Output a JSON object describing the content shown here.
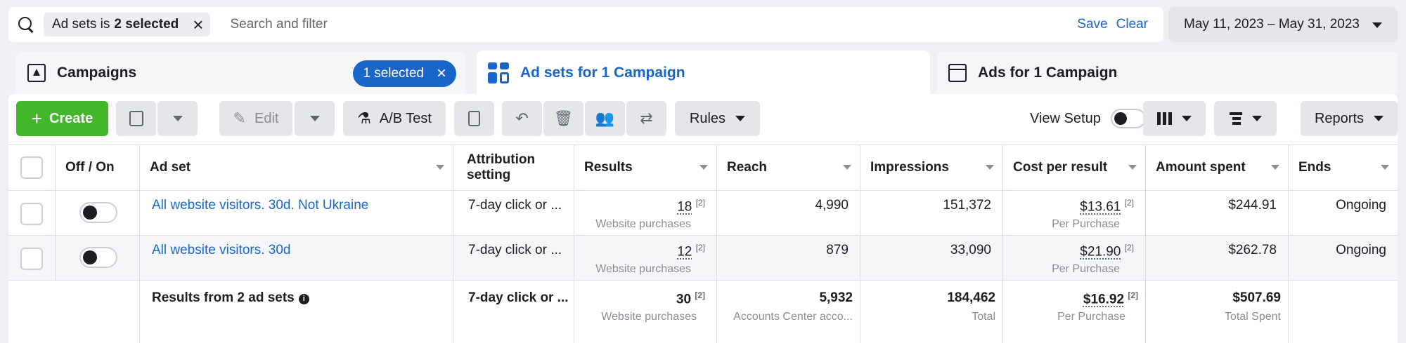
{
  "search": {
    "filter_prefix": "Ad sets is",
    "filter_value": "2 selected",
    "chip_close": "×",
    "placeholder": "Search and filter",
    "save": "Save",
    "clear": "Clear"
  },
  "date_range": "May 11, 2023 – May 31, 2023",
  "tabs": {
    "campaigns": "Campaigns",
    "campaigns_selected": "1 selected",
    "campaigns_selected_close": "×",
    "adsets": "Ad sets for 1 Campaign",
    "ads": "Ads for 1 Campaign"
  },
  "toolbar": {
    "create": "Create",
    "create_plus": "+",
    "edit": "Edit",
    "ab_test": "A/B Test",
    "rules": "Rules",
    "view_setup": "View Setup",
    "reports": "Reports"
  },
  "table": {
    "headers": {
      "off_on": "Off / On",
      "adset": "Ad set",
      "attribution": "Attribution setting",
      "results": "Results",
      "reach": "Reach",
      "impressions": "Impressions",
      "cost_per_result": "Cost per result",
      "amount_spent": "Amount spent",
      "ends": "Ends"
    },
    "rows": [
      {
        "name": "All website visitors. 30d. Not Ukraine",
        "attribution": "7-day click or ...",
        "results": "18",
        "results_note": "[2]",
        "results_sub": "Website purchases",
        "reach": "4,990",
        "impressions": "151,372",
        "cpr": "$13.61",
        "cpr_note": "[2]",
        "cpr_sub": "Per Purchase",
        "spent": "$244.91",
        "ends": "Ongoing"
      },
      {
        "name": "All website visitors. 30d",
        "attribution": "7-day click or ...",
        "results": "12",
        "results_note": "[2]",
        "results_sub": "Website purchases",
        "reach": "879",
        "impressions": "33,090",
        "cpr": "$21.90",
        "cpr_note": "[2]",
        "cpr_sub": "Per Purchase",
        "spent": "$262.78",
        "ends": "Ongoing"
      }
    ],
    "totals": {
      "label": "Results from 2 ad sets",
      "info": "i",
      "attribution": "7-day click or ...",
      "results": "30",
      "results_note": "[2]",
      "results_sub": "Website purchases",
      "reach": "5,932",
      "reach_sub": "Accounts Center acco...",
      "impressions": "184,462",
      "impressions_sub": "Total",
      "cpr": "$16.92",
      "cpr_note": "[2]",
      "cpr_sub": "Per Purchase",
      "spent": "$507.69",
      "spent_sub": "Total Spent"
    }
  },
  "icons": {
    "search": "search-icon",
    "campaign": "campaign-icon",
    "adsets": "adsets-grid-icon",
    "ads": "ads-icon"
  },
  "colors": {
    "accent": "#1a65c8",
    "create": "#42b72a"
  }
}
